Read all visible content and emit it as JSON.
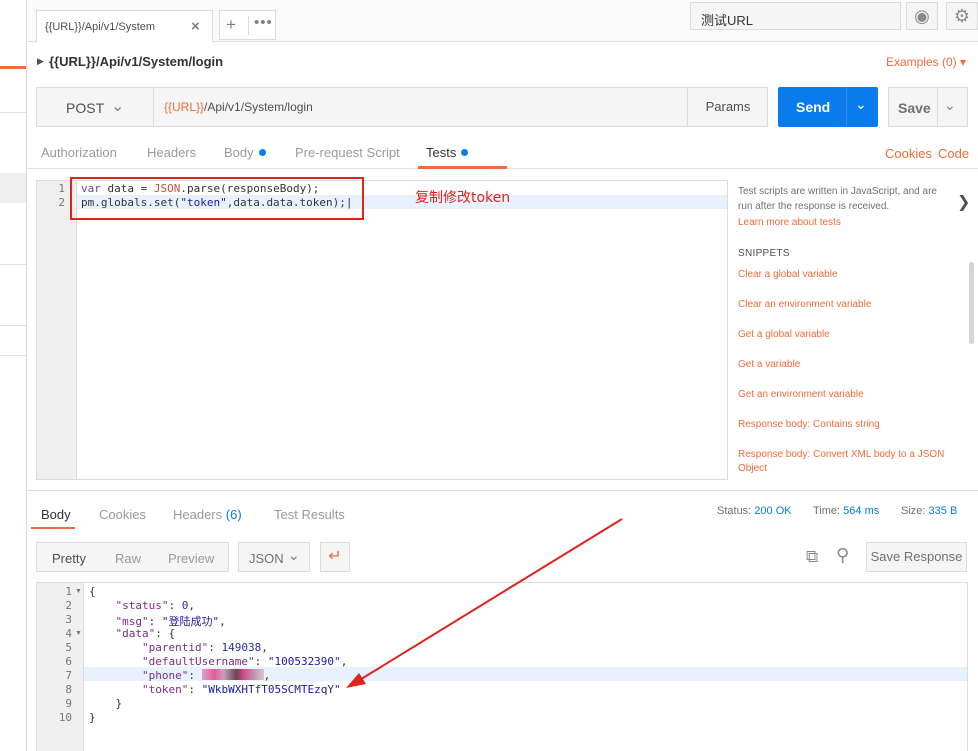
{
  "tabstrip": {
    "active_tab_label": "{{URL}}/Api/v1/System",
    "close_glyph": "×",
    "new_tab_glyph": "+",
    "more_glyph": "•••",
    "environment": "测试URL",
    "icons": [
      "eye-icon",
      "gear-icon"
    ]
  },
  "request": {
    "title": "{{URL}}/Api/v1/System/login",
    "examples_label": "Examples (0)",
    "method": "POST",
    "url_var": "{{URL}}",
    "url_path": "/Api/v1/System/login",
    "params_label": "Params",
    "send_label": "Send",
    "save_label": "Save"
  },
  "request_tabs": {
    "items": [
      {
        "label": "Authorization"
      },
      {
        "label": "Headers"
      },
      {
        "label": "Body"
      },
      {
        "label": "Pre-request Script"
      },
      {
        "label": "Tests"
      }
    ],
    "active": "Tests",
    "cookies_label": "Cookies",
    "code_label": "Code"
  },
  "tests_editor": {
    "lines": [
      {
        "num": "1",
        "text": "var data = JSON.parse(responseBody);"
      },
      {
        "num": "2",
        "text": "pm.globals.set(\"token\",data.data.token);"
      }
    ]
  },
  "annotation": {
    "text": "复制修改token",
    "color": "#e0241b"
  },
  "help_panel": {
    "description": "Test scripts are written in JavaScript, and are run after the response is received.",
    "learn_more": "Learn more about tests",
    "snippets_title": "SNIPPETS",
    "snippets": [
      "Clear a global variable",
      "Clear an environment variable",
      "Get a global variable",
      "Get a variable",
      "Get an environment variable",
      "Response body: Contains string",
      "Response body: Convert XML body to a JSON Object"
    ]
  },
  "response": {
    "tabs": [
      "Body",
      "Cookies",
      "Headers",
      "(6)",
      "Test Results"
    ],
    "status_label": "Status:",
    "status_value": "200 OK",
    "time_label": "Time:",
    "time_value": "564 ms",
    "size_label": "Size:",
    "size_value": "335 B",
    "view_modes": [
      "Pretty",
      "Raw",
      "Preview"
    ],
    "active_view": "Pretty",
    "format": "JSON",
    "save_response_label": "Save Response",
    "body_lines": [
      {
        "num": "1",
        "text": "{"
      },
      {
        "num": "2",
        "key": "\"status\"",
        "sep": ": ",
        "value": "0",
        "tail": ","
      },
      {
        "num": "3",
        "key": "\"msg\"",
        "sep": ": ",
        "value": "\"登陆成功\"",
        "tail": ","
      },
      {
        "num": "4",
        "key": "\"data\"",
        "sep": ": ",
        "tail": "{"
      },
      {
        "num": "5",
        "key": "\"parentid\"",
        "sep": ": ",
        "value": "149038",
        "tail": ","
      },
      {
        "num": "6",
        "key": "\"defaultUsername\"",
        "sep": ": ",
        "value": "\"100532390\"",
        "tail": ","
      },
      {
        "num": "7",
        "key": "\"phone\"",
        "sep": ": ",
        "tail": ","
      },
      {
        "num": "8",
        "key": "\"token\"",
        "sep": ": ",
        "value": "\"WkbWXHTfT05SCMTEzqY\""
      },
      {
        "num": "9",
        "text": "}"
      },
      {
        "num": "10",
        "text": "}"
      }
    ]
  },
  "colors": {
    "accent": "#f26b3a",
    "primary": "#097bed",
    "annotation": "#e0241b"
  }
}
